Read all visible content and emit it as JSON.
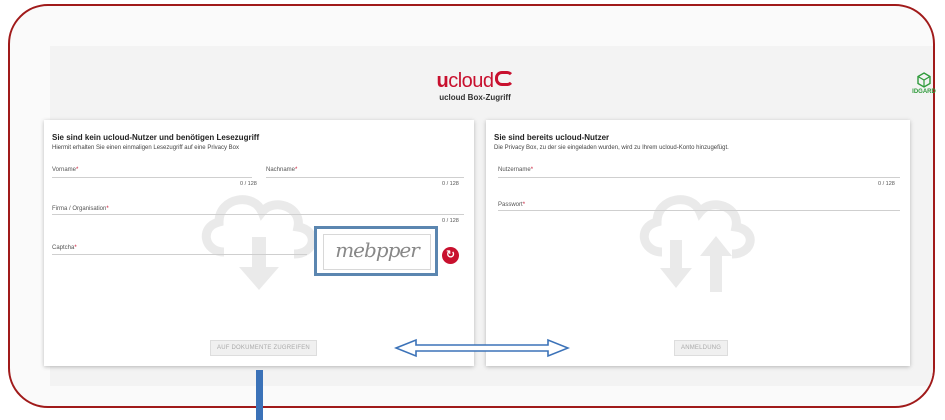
{
  "header": {
    "logo_u": "u",
    "logo_cloud": "cloud",
    "subtitle": "ucloud Box-Zugriff",
    "partner_label": "IDGARD"
  },
  "guest": {
    "title": "Sie sind kein ucloud-Nutzer und benötigen Lesezugriff",
    "description": "Hiermit erhalten Sie einen einmaligen Lesezugriff auf eine Privacy Box",
    "firstname_label": "Vorname",
    "firstname_counter": "0 / 128",
    "lastname_label": "Nachname",
    "lastname_counter": "0 / 128",
    "company_label": "Firma / Organisation",
    "company_counter": "0 / 128",
    "captcha_label": "Captcha",
    "captcha_text": "mebpper",
    "required_mark": "*",
    "submit_label": "AUF DOKUMENTE ZUGREIFEN"
  },
  "member": {
    "title": "Sie sind bereits ucloud-Nutzer",
    "description": "Die Privacy Box, zu der sie eingeladen wurden, wird zu Ihrem ucloud-Konto hinzugefügt.",
    "username_label": "Nutzername",
    "username_counter": "0 / 128",
    "password_label": "Passwort",
    "required_mark": "*",
    "login_label": "ANMELDUNG"
  },
  "colors": {
    "brand": "#c8102e",
    "annotation": "#3b72b8",
    "frame": "#a01a1a"
  },
  "icons": [
    "cloud-download-icon",
    "cloud-transfer-icon",
    "refresh-icon",
    "idgard-logo-icon"
  ]
}
